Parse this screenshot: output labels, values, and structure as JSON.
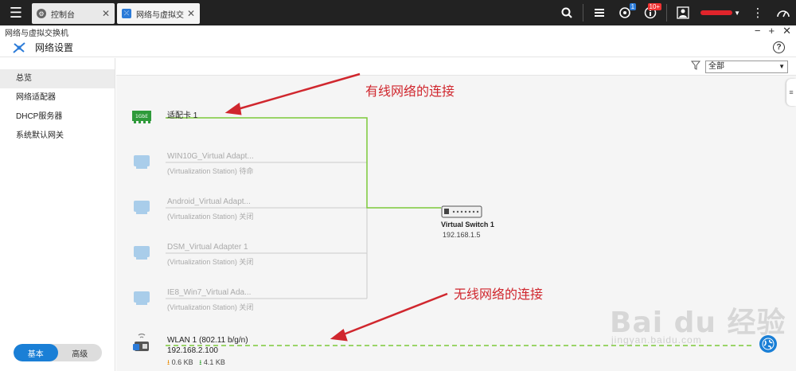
{
  "topbar": {
    "tabs": [
      {
        "label": "控制台",
        "icon": "gear-icon"
      },
      {
        "label": "网络与虚拟交...",
        "icon": "network-icon"
      }
    ],
    "badges": {
      "backup": "1",
      "notifications": "10+"
    }
  },
  "window": {
    "title": "网络与虚拟交换机",
    "minimize": "−",
    "maximize": "+",
    "close": "✕"
  },
  "app": {
    "title": "网络设置",
    "help": "?"
  },
  "sidebar": {
    "items": [
      {
        "label": "总览"
      },
      {
        "label": "网络适配器"
      },
      {
        "label": "DHCP服务器"
      },
      {
        "label": "系统默认网关"
      }
    ],
    "mode_basic": "基本",
    "mode_advanced": "高级"
  },
  "filter": {
    "selected": "全部"
  },
  "adapters": [
    {
      "name": "适配卡 1",
      "icon_text": "1GbE",
      "active": true
    },
    {
      "name": "WIN10G_Virtual Adapt...",
      "status": "(Virtualization Station) 待命"
    },
    {
      "name": "Android_Virtual Adapt...",
      "status": "(Virtualization Station) 关闭"
    },
    {
      "name": "DSM_Virtual Adapter 1",
      "status": "(Virtualization Station) 关闭"
    },
    {
      "name": "IE8_Win7_Virtual Ada...",
      "status": "(Virtualization Station) 关闭"
    }
  ],
  "switch": {
    "name": "Virtual Switch 1",
    "ip": "192.168.1.5"
  },
  "wlan": {
    "name": "WLAN 1 (802.11 b/g/n)",
    "ip": "192.168.2.100",
    "upload": "0.6 KB",
    "download": "4.1 KB"
  },
  "annotations": {
    "wired": "有线网络的连接",
    "wireless": "无线网络的连接"
  },
  "watermark": {
    "brand": "Bai du 经验",
    "url": "jingyan.baidu.com"
  },
  "colors": {
    "link_active": "#7dc93a",
    "link_inactive": "#cccccc",
    "annotation": "#d0272e",
    "accent": "#1a7fd6"
  }
}
